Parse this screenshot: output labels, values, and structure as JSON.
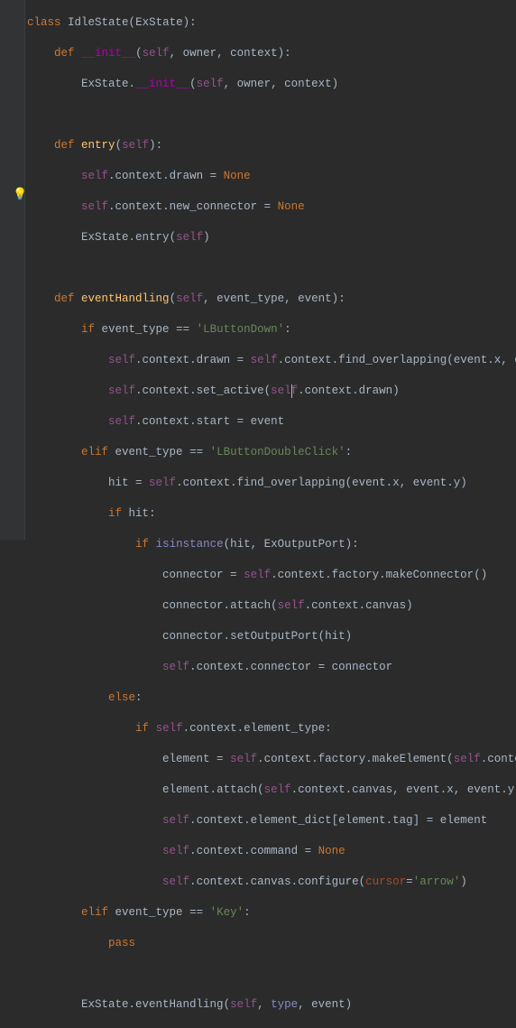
{
  "kw": {
    "class": "class",
    "def": "def",
    "if": "if",
    "elif": "elif",
    "else": "else",
    "pass": "pass",
    "self": "self",
    "none": "None",
    "isinstance": "isinstance"
  },
  "names": {
    "IdleState": "IdleState",
    "ExState": "ExState",
    "init": "__init__",
    "owner": "owner",
    "context": "context",
    "entry": "entry",
    "drawn": "drawn",
    "new_connector": "new_connector",
    "eventHandling": "eventHandling",
    "event_type": "event_type",
    "event": "event",
    "find_overlapping": "find_overlapping",
    "x": "x",
    "y": "y",
    "set_active": "set_active",
    "start": "start",
    "hit": "hit",
    "ExOutputPort": "ExOutputPort",
    "connector": "connector",
    "factory": "factory",
    "makeConnector": "makeConnector",
    "attach": "attach",
    "canvas": "canvas",
    "setOutputPort": "setOutputPort",
    "element_type": "element_type",
    "element": "element",
    "makeElement": "makeElement",
    "element_dict": "element_dict",
    "tag": "tag",
    "command": "command",
    "configure": "configure",
    "cursor": "cursor",
    "type": "type"
  },
  "strings": {
    "LButtonDown": "'LButtonDown'",
    "LButtonDoubleClick": "'LButtonDoubleClick'",
    "Key": "'Key'",
    "arrow": "'arrow'"
  },
  "punct": {
    "colon": ":",
    "comma": ", ",
    "dot": ".",
    "lp": "(",
    "rp": ")",
    "eq": " = ",
    "eqeq": " == ",
    "lb": "[",
    "rb": "]",
    "assigneq": "="
  }
}
